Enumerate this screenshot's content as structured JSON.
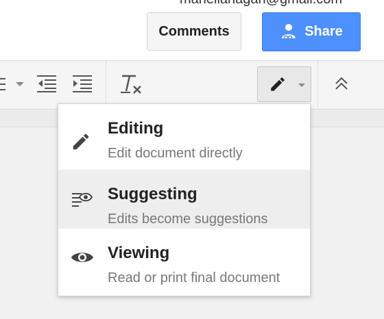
{
  "header": {
    "user_email": "maneliahagan@gmail.com",
    "comments_label": "Comments",
    "share_label": "Share",
    "share_color": "#4d90fe"
  },
  "toolbar": {
    "icons": [
      "bulleted-list-icon",
      "dropdown-arrow-icon",
      "decrease-indent-icon",
      "increase-indent-icon",
      "clear-formatting-icon",
      "pencil-icon",
      "collapse-icon"
    ]
  },
  "mode_menu": {
    "items": [
      {
        "title": "Editing",
        "description": "Edit document directly",
        "icon": "pencil-icon"
      },
      {
        "title": "Suggesting",
        "description": "Edits become suggestions",
        "icon": "suggest-icon",
        "highlighted": true
      },
      {
        "title": "Viewing",
        "description": "Read or print final document",
        "icon": "eye-icon"
      }
    ]
  }
}
